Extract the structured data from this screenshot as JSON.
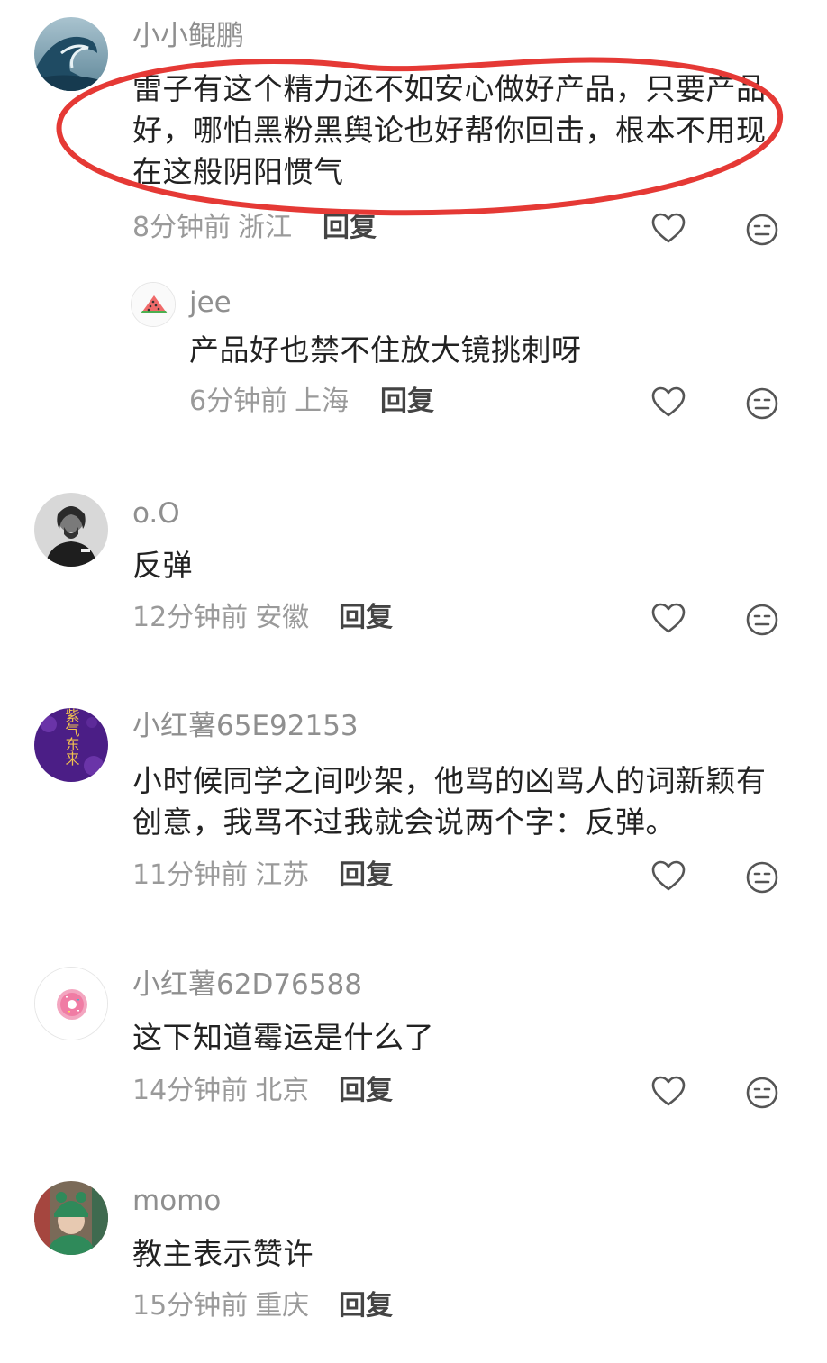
{
  "comments": [
    {
      "username": "小小鲲鹏",
      "text": "雷子有这个精力还不如安心做好产品，只要产品好，哪怕黑粉黑舆论也好帮你回击，根本不用现在这般阴阳惯气",
      "time": "8分钟前",
      "location": "浙江",
      "reply_label": "回复",
      "avatar_icon": "wave-avatar",
      "replies": [
        {
          "username": "jee",
          "text": "产品好也禁不住放大镜挑刺呀",
          "time": "6分钟前",
          "location": "上海",
          "reply_label": "回复",
          "avatar_icon": "watermelon-avatar"
        }
      ]
    },
    {
      "username": "o.O",
      "text": "反弹",
      "time": "12分钟前",
      "location": "安徽",
      "reply_label": "回复",
      "avatar_icon": "portrait-avatar"
    },
    {
      "username": "小红薯65E92153",
      "text": "小时候同学之间吵架，他骂的凶骂人的词新颖有创意，我骂不过我就会说两个字：反弹。",
      "time": "11分钟前",
      "location": "江苏",
      "reply_label": "回复",
      "avatar_icon": "purple-calligraphy-avatar",
      "avatar_text": "紫气东来"
    },
    {
      "username": "小红薯62D76588",
      "text": "这下知道霉运是什么了",
      "time": "14分钟前",
      "location": "北京",
      "reply_label": "回复",
      "avatar_icon": "donut-avatar"
    },
    {
      "username": "momo",
      "text": "教主表示赞许",
      "time": "15分钟前",
      "location": "重庆",
      "reply_label": "回复",
      "avatar_icon": "green-hat-avatar"
    }
  ],
  "colors": {
    "highlight_ellipse": "#e53935",
    "username": "#8f8f8f",
    "text": "#222222",
    "meta": "#9a9a9a"
  }
}
